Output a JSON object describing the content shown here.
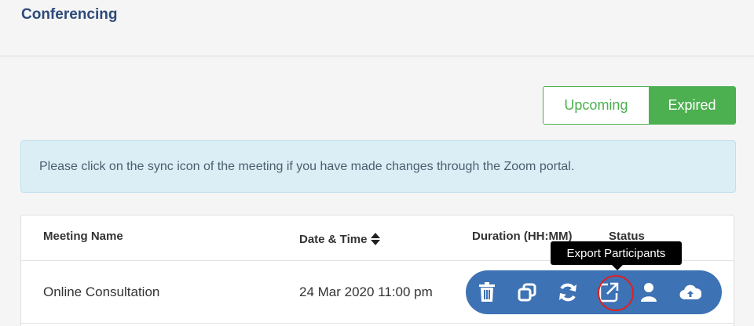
{
  "header": {
    "title": "Conferencing"
  },
  "toggle": {
    "upcoming": "Upcoming",
    "expired": "Expired",
    "active": "Expired"
  },
  "info": {
    "message": "Please click on the sync icon of the meeting if you have made changes through the Zoom portal."
  },
  "table": {
    "columns": [
      "Meeting Name",
      "Date & Time",
      "Duration (HH:MM)",
      "Status"
    ],
    "rows": [
      {
        "name": "Online Consultation",
        "datetime": "24 Mar 2020 11:00 pm"
      }
    ]
  },
  "actions": [
    "trash-icon",
    "copy-icon",
    "sync-icon",
    "export-icon",
    "participant-icon",
    "cloud-upload-icon"
  ],
  "tooltip": {
    "text": "Export Participants"
  },
  "colors": {
    "accent": "#4caf50",
    "primary": "#3d72b4",
    "title": "#2e4a7a",
    "info_bg": "#dbeef6",
    "highlight": "#e02020"
  }
}
